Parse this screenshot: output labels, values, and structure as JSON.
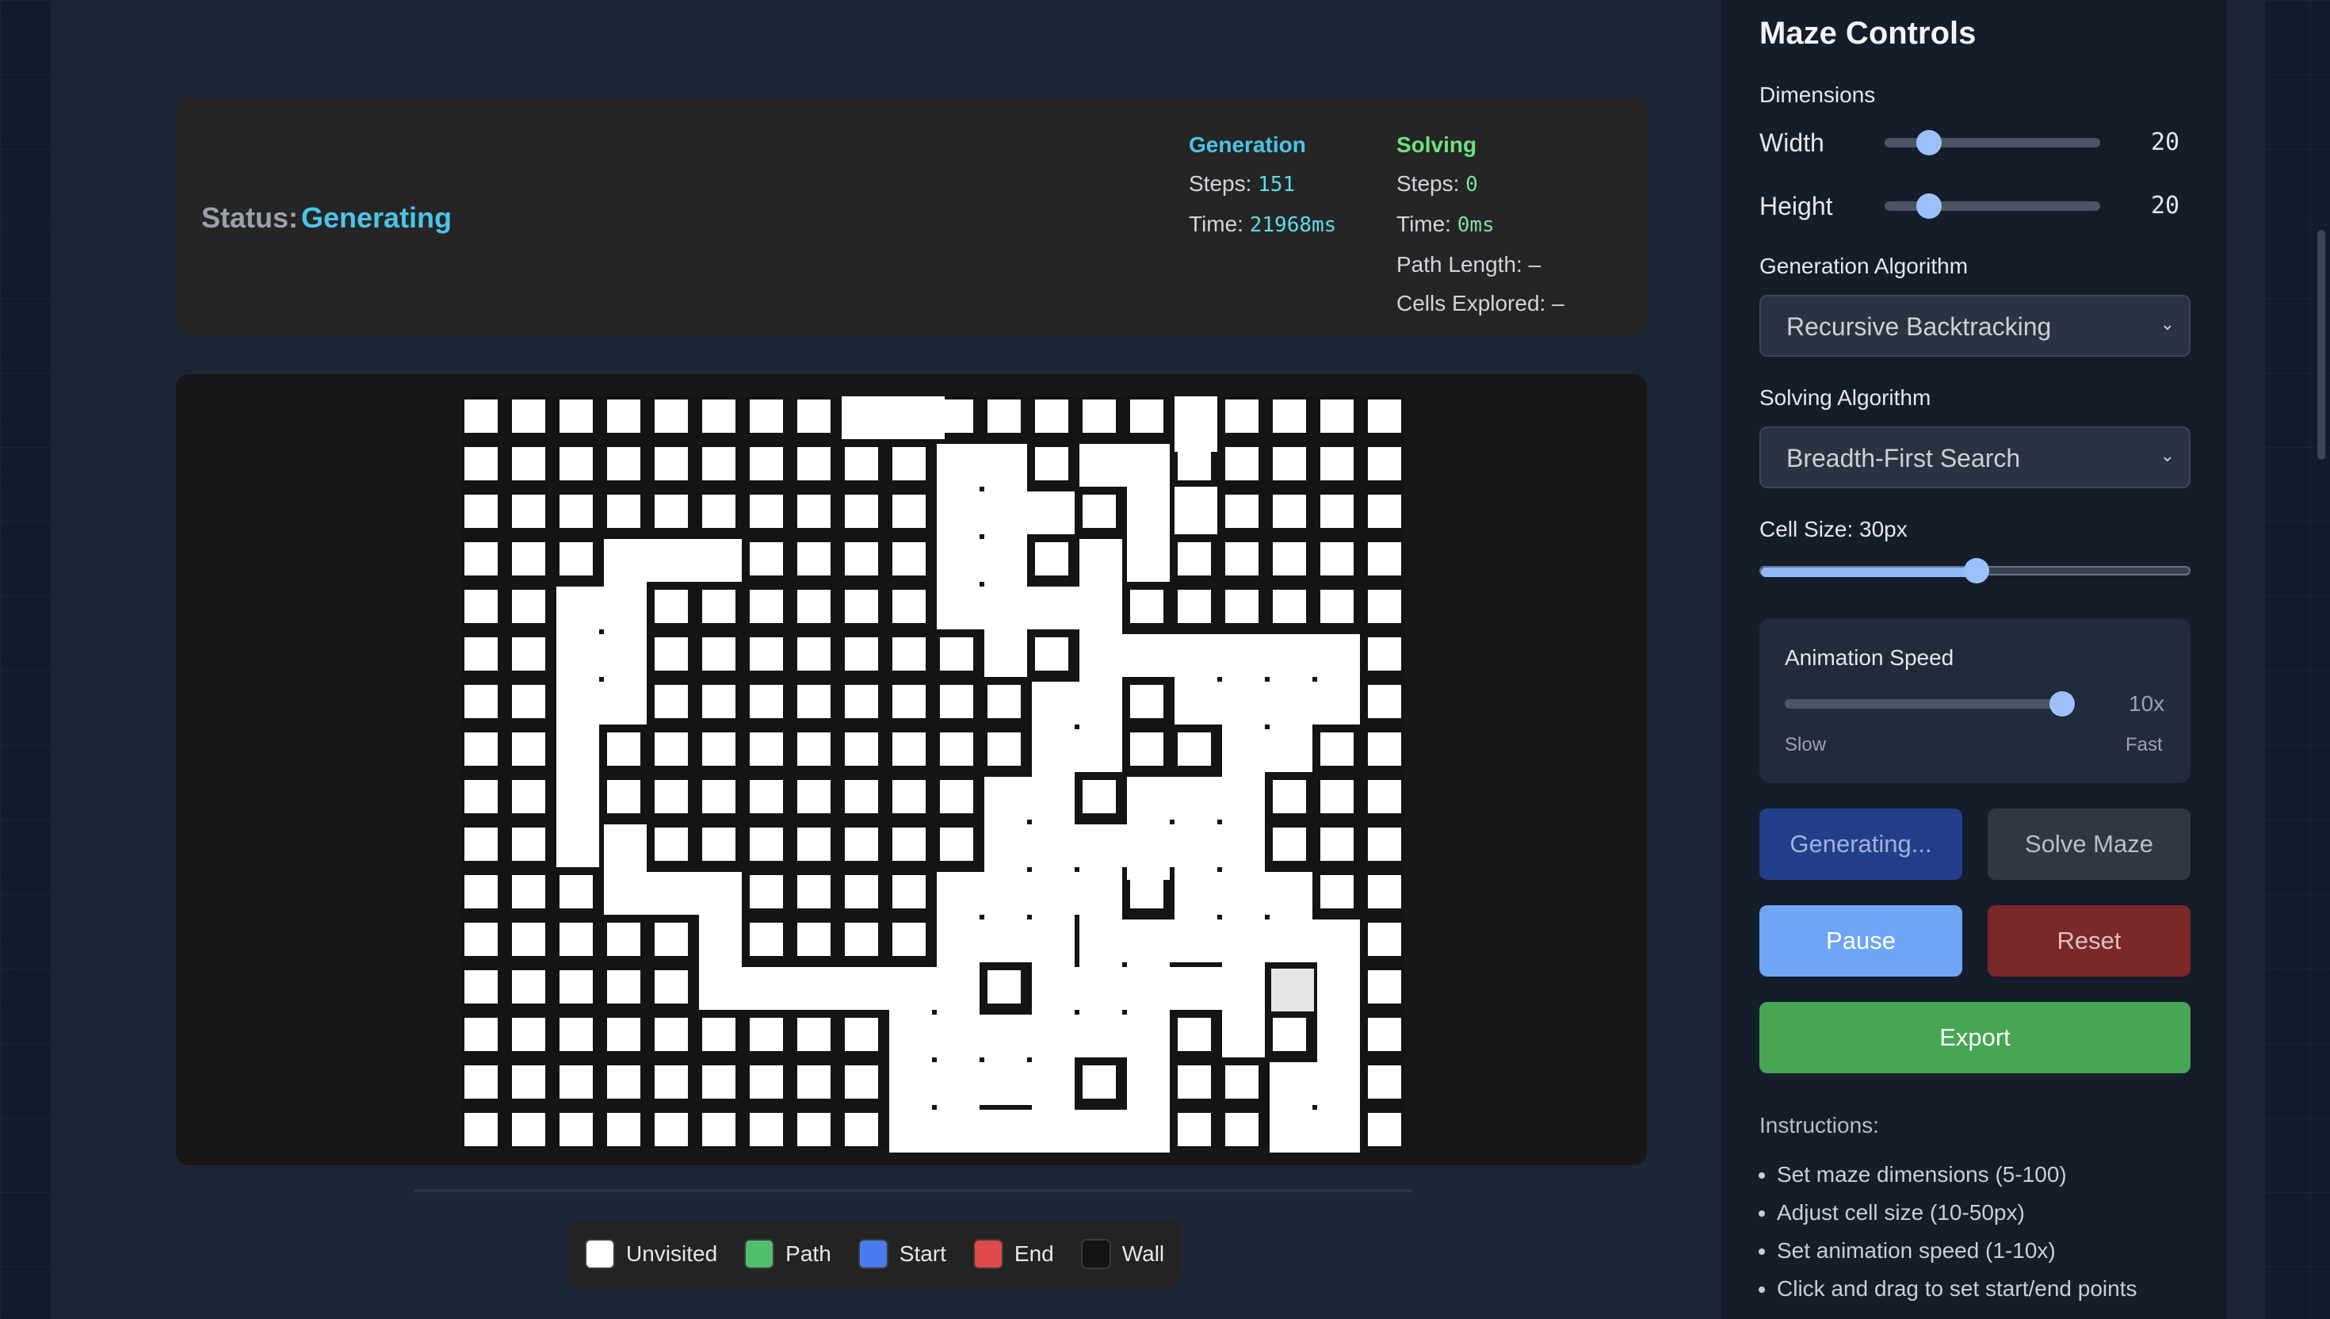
{
  "status": {
    "label": "Status:",
    "value": "Generating"
  },
  "generation": {
    "header": "Generation",
    "steps_label": "Steps:",
    "steps": "151",
    "time_label": "Time:",
    "time": "21968ms"
  },
  "solving": {
    "header": "Solving",
    "steps_label": "Steps:",
    "steps": "0",
    "time_label": "Time:",
    "time": "0ms",
    "path_length": "Path Length: –",
    "cells_explored": "Cells Explored: –"
  },
  "legend": [
    {
      "label": "Unvisited",
      "color": "#ffffff"
    },
    {
      "label": "Path",
      "color": "#4fbf6a"
    },
    {
      "label": "Start",
      "color": "#4a7cf0"
    },
    {
      "label": "End",
      "color": "#e04a4a"
    },
    {
      "label": "Wall",
      "color": "#141414"
    }
  ],
  "panel": {
    "title": "Maze Controls",
    "dimensions_label": "Dimensions",
    "width_label": "Width",
    "width_value": "20",
    "height_label": "Height",
    "height_value": "20",
    "generation_algorithm_label": "Generation Algorithm",
    "generation_algorithm": "Recursive Backtracking",
    "solving_algorithm_label": "Solving Algorithm",
    "solving_algorithm": "Breadth-First Search",
    "cell_size_label": "Cell Size: 30px",
    "animation_speed_label": "Animation Speed",
    "animation_speed_value": "10x",
    "slow_label": "Slow",
    "fast_label": "Fast",
    "generate_button": "Generating...",
    "solve_button": "Solve Maze",
    "pause_button": "Pause",
    "reset_button": "Reset",
    "export_button": "Export",
    "instructions_title": "Instructions:",
    "instructions": [
      "Set maze dimensions (5-100)",
      "Adjust cell size (10-50px)",
      "Set animation speed (1-10x)",
      "Click and drag to set start/end points"
    ]
  },
  "sliders": {
    "width_level": 0.2,
    "height_level": 0.2,
    "cell_size_level": 0.5,
    "speed_level": 1.0
  },
  "colors": {
    "accent": "#4cc3e8",
    "solving": "#6ee27a",
    "pause": "#6fa5f5",
    "reset": "#7b2828",
    "export": "#47a653",
    "generate": "#233f8a"
  },
  "maze": {
    "cols": 20,
    "rows": 16,
    "current_cell": [
      17,
      12
    ],
    "open_cells": [
      [
        8,
        0
      ],
      [
        9,
        0
      ],
      [
        15,
        0
      ],
      [
        10,
        1
      ],
      [
        11,
        1
      ],
      [
        13,
        1
      ],
      [
        14,
        1
      ],
      [
        10,
        2
      ],
      [
        11,
        2
      ],
      [
        12,
        2
      ],
      [
        14,
        2
      ],
      [
        15,
        2
      ],
      [
        3,
        3
      ],
      [
        4,
        3
      ],
      [
        5,
        3
      ],
      [
        10,
        3
      ],
      [
        11,
        3
      ],
      [
        13,
        3
      ],
      [
        14,
        3
      ],
      [
        2,
        4
      ],
      [
        3,
        4
      ],
      [
        10,
        4
      ],
      [
        11,
        4
      ],
      [
        12,
        4
      ],
      [
        13,
        4
      ],
      [
        2,
        5
      ],
      [
        3,
        5
      ],
      [
        11,
        5
      ],
      [
        13,
        5
      ],
      [
        14,
        5
      ],
      [
        15,
        5
      ],
      [
        16,
        5
      ],
      [
        17,
        5
      ],
      [
        18,
        5
      ],
      [
        2,
        6
      ],
      [
        3,
        6
      ],
      [
        12,
        6
      ],
      [
        13,
        6
      ],
      [
        15,
        6
      ],
      [
        16,
        6
      ],
      [
        17,
        6
      ],
      [
        18,
        6
      ],
      [
        2,
        7
      ],
      [
        12,
        7
      ],
      [
        13,
        7
      ],
      [
        16,
        7
      ],
      [
        17,
        7
      ],
      [
        2,
        8
      ],
      [
        11,
        8
      ],
      [
        12,
        8
      ],
      [
        14,
        8
      ],
      [
        15,
        8
      ],
      [
        16,
        8
      ],
      [
        2,
        9
      ],
      [
        3,
        9
      ],
      [
        11,
        9
      ],
      [
        12,
        9
      ],
      [
        13,
        9
      ],
      [
        14,
        9
      ],
      [
        15,
        9
      ],
      [
        16,
        9
      ],
      [
        3,
        10
      ],
      [
        4,
        10
      ],
      [
        5,
        10
      ],
      [
        10,
        10
      ],
      [
        11,
        10
      ],
      [
        12,
        10
      ],
      [
        13,
        10
      ],
      [
        15,
        10
      ],
      [
        16,
        10
      ],
      [
        17,
        10
      ],
      [
        5,
        11
      ],
      [
        10,
        11
      ],
      [
        11,
        11
      ],
      [
        12,
        11
      ],
      [
        13,
        11
      ],
      [
        14,
        11
      ],
      [
        15,
        11
      ],
      [
        16,
        11
      ],
      [
        17,
        11
      ],
      [
        18,
        11
      ],
      [
        5,
        12
      ],
      [
        6,
        12
      ],
      [
        7,
        12
      ],
      [
        8,
        12
      ],
      [
        9,
        12
      ],
      [
        10,
        12
      ],
      [
        12,
        12
      ],
      [
        13,
        12
      ],
      [
        14,
        12
      ],
      [
        15,
        12
      ],
      [
        16,
        12
      ],
      [
        18,
        12
      ],
      [
        9,
        13
      ],
      [
        10,
        13
      ],
      [
        11,
        13
      ],
      [
        12,
        13
      ],
      [
        13,
        13
      ],
      [
        14,
        13
      ],
      [
        16,
        13
      ],
      [
        18,
        13
      ],
      [
        9,
        14
      ],
      [
        10,
        14
      ],
      [
        11,
        14
      ],
      [
        12,
        14
      ],
      [
        14,
        14
      ],
      [
        17,
        14
      ],
      [
        18,
        14
      ],
      [
        9,
        15
      ],
      [
        10,
        15
      ],
      [
        11,
        15
      ],
      [
        12,
        15
      ],
      [
        13,
        15
      ],
      [
        14,
        15
      ],
      [
        17,
        15
      ],
      [
        18,
        15
      ]
    ],
    "open_edges_h": [
      [
        8,
        0
      ],
      [
        9,
        0
      ],
      [
        10,
        1
      ],
      [
        13,
        1
      ],
      [
        10,
        2
      ],
      [
        11,
        2
      ],
      [
        3,
        3
      ],
      [
        4,
        3
      ],
      [
        10,
        3
      ],
      [
        2,
        4
      ],
      [
        10,
        4
      ],
      [
        11,
        4
      ],
      [
        12,
        4
      ],
      [
        2,
        5
      ],
      [
        13,
        5
      ],
      [
        14,
        5
      ],
      [
        15,
        5
      ],
      [
        16,
        5
      ],
      [
        17,
        5
      ],
      [
        2,
        6
      ],
      [
        12,
        6
      ],
      [
        15,
        6
      ],
      [
        16,
        6
      ],
      [
        17,
        6
      ],
      [
        12,
        7
      ],
      [
        16,
        7
      ],
      [
        11,
        8
      ],
      [
        14,
        8
      ],
      [
        15,
        8
      ],
      [
        11,
        9
      ],
      [
        12,
        9
      ],
      [
        13,
        9
      ],
      [
        14,
        9
      ],
      [
        15,
        9
      ],
      [
        3,
        10
      ],
      [
        4,
        10
      ],
      [
        10,
        10
      ],
      [
        11,
        10
      ],
      [
        12,
        10
      ],
      [
        15,
        10
      ],
      [
        16,
        10
      ],
      [
        10,
        11
      ],
      [
        11,
        11
      ],
      [
        13,
        11
      ],
      [
        14,
        11
      ],
      [
        15,
        11
      ],
      [
        16,
        11
      ],
      [
        17,
        11
      ],
      [
        5,
        12
      ],
      [
        6,
        12
      ],
      [
        7,
        12
      ],
      [
        8,
        12
      ],
      [
        9,
        12
      ],
      [
        12,
        12
      ],
      [
        13,
        12
      ],
      [
        14,
        12
      ],
      [
        15,
        12
      ],
      [
        9,
        13
      ],
      [
        10,
        13
      ],
      [
        11,
        13
      ],
      [
        12,
        13
      ],
      [
        13,
        13
      ],
      [
        9,
        14
      ],
      [
        10,
        14
      ],
      [
        11,
        14
      ],
      [
        17,
        14
      ],
      [
        9,
        15
      ],
      [
        10,
        15
      ],
      [
        11,
        15
      ],
      [
        12,
        15
      ],
      [
        13,
        15
      ],
      [
        17,
        15
      ]
    ],
    "open_edges_v": [
      [
        15,
        0
      ],
      [
        10,
        1
      ],
      [
        11,
        1
      ],
      [
        14,
        1
      ],
      [
        15,
        1
      ],
      [
        10,
        2
      ],
      [
        11,
        2
      ],
      [
        14,
        2
      ],
      [
        3,
        3
      ],
      [
        10,
        3
      ],
      [
        11,
        3
      ],
      [
        13,
        3
      ],
      [
        2,
        4
      ],
      [
        3,
        4
      ],
      [
        11,
        4
      ],
      [
        13,
        4
      ],
      [
        2,
        5
      ],
      [
        3,
        5
      ],
      [
        13,
        5
      ],
      [
        15,
        5
      ],
      [
        16,
        5
      ],
      [
        17,
        5
      ],
      [
        18,
        5
      ],
      [
        2,
        6
      ],
      [
        12,
        6
      ],
      [
        13,
        6
      ],
      [
        16,
        6
      ],
      [
        17,
        6
      ],
      [
        2,
        7
      ],
      [
        12,
        7
      ],
      [
        16,
        7
      ],
      [
        2,
        8
      ],
      [
        11,
        8
      ],
      [
        12,
        8
      ],
      [
        14,
        8
      ],
      [
        15,
        8
      ],
      [
        16,
        8
      ],
      [
        3,
        9
      ],
      [
        11,
        9
      ],
      [
        12,
        9
      ],
      [
        13,
        9
      ],
      [
        14,
        9
      ],
      [
        15,
        9
      ],
      [
        16,
        9
      ],
      [
        5,
        10
      ],
      [
        10,
        10
      ],
      [
        11,
        10
      ],
      [
        12,
        10
      ],
      [
        13,
        10
      ],
      [
        15,
        10
      ],
      [
        16,
        10
      ],
      [
        17,
        10
      ],
      [
        5,
        11
      ],
      [
        10,
        11
      ],
      [
        12,
        11
      ],
      [
        13,
        11
      ],
      [
        14,
        11
      ],
      [
        16,
        11
      ],
      [
        18,
        11
      ],
      [
        9,
        12
      ],
      [
        10,
        12
      ],
      [
        12,
        12
      ],
      [
        13,
        12
      ],
      [
        14,
        12
      ],
      [
        16,
        12
      ],
      [
        18,
        12
      ],
      [
        9,
        13
      ],
      [
        10,
        13
      ],
      [
        11,
        13
      ],
      [
        12,
        13
      ],
      [
        14,
        13
      ],
      [
        18,
        13
      ],
      [
        9,
        14
      ],
      [
        10,
        14
      ],
      [
        12,
        14
      ],
      [
        14,
        14
      ],
      [
        17,
        14
      ],
      [
        18,
        14
      ]
    ]
  }
}
